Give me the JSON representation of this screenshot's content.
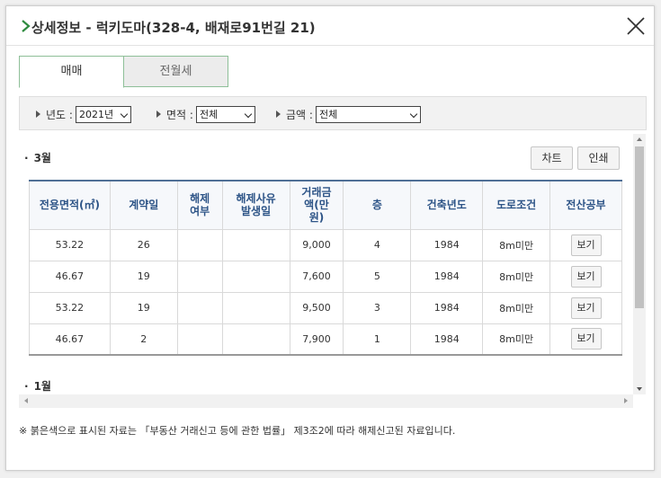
{
  "dialog": {
    "title": "상세정보 - 럭키도마(328-4, 배재로91번길 21)",
    "accent_color": "#2e8b3f"
  },
  "tabs": [
    {
      "label": "매매",
      "active": true
    },
    {
      "label": "전월세",
      "active": false
    }
  ],
  "filters": {
    "year": {
      "label": "년도 :",
      "value": "2021년"
    },
    "area": {
      "label": "면적 :",
      "value": "전체"
    },
    "amount": {
      "label": "금액 :",
      "value": "전체"
    }
  },
  "actions": {
    "chart_label": "차트",
    "print_label": "인쇄"
  },
  "months": [
    "3월",
    "1월"
  ],
  "table": {
    "headers": [
      "전용면적(㎡)",
      "계약일",
      "해제\n여부",
      "해제사유\n발생일",
      "거래금\n액(만\n원)",
      "층",
      "건축년도",
      "도로조건",
      "전산공부"
    ],
    "rows": [
      [
        "53.22",
        "26",
        "",
        "",
        "9,000",
        "4",
        "1984",
        "8m미만",
        "보기"
      ],
      [
        "46.67",
        "19",
        "",
        "",
        "7,600",
        "5",
        "1984",
        "8m미만",
        "보기"
      ],
      [
        "53.22",
        "19",
        "",
        "",
        "9,500",
        "3",
        "1984",
        "8m미만",
        "보기"
      ],
      [
        "46.67",
        "2",
        "",
        "",
        "7,900",
        "1",
        "1984",
        "8m미만",
        "보기"
      ]
    ]
  },
  "footnote": "※ 붉은색으로 표시된 자료는 「부동산 거래신고 등에 관한 법률」 제3조2에 따라 해제신고된 자료입니다."
}
